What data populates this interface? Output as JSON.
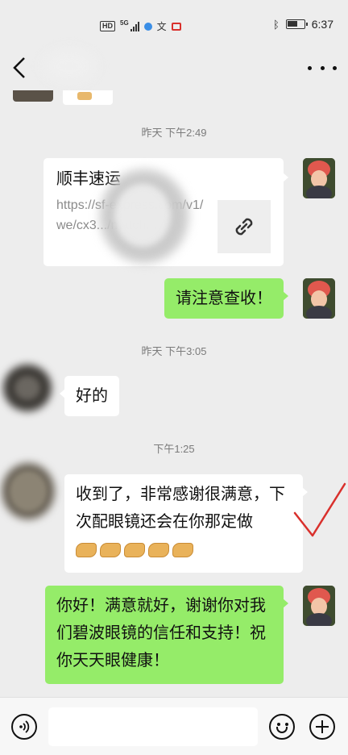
{
  "status_bar": {
    "hd_label": "HD",
    "network_label": "5G",
    "app_icon_text": "文",
    "time": "6:37"
  },
  "messages": [
    {
      "type": "time",
      "text": "昨天 下午2:49"
    },
    {
      "type": "link_card",
      "side": "right",
      "title": "顺丰速运",
      "description": "https://sf-express.com/v1/we/cx3.../match..."
    },
    {
      "type": "text",
      "side": "right",
      "text": "请注意查收！"
    },
    {
      "type": "time",
      "text": "昨天 下午3:05"
    },
    {
      "type": "text",
      "side": "left",
      "text": "好的"
    },
    {
      "type": "time",
      "text": "下午1:25"
    },
    {
      "type": "text",
      "side": "left",
      "text": "收到了，非常感谢很满意，下次配眼镜还会在你那定做",
      "emoji": [
        "ok-hand",
        "ok-hand",
        "handshake",
        "handshake",
        "handshake"
      ]
    },
    {
      "type": "text",
      "side": "right",
      "text": "你好！满意就好，谢谢你对我们碧波眼镜的信任和支持！祝你天天眼健康！"
    }
  ],
  "input_bar": {
    "placeholder": ""
  },
  "colors": {
    "background": "#ededed",
    "sent_bubble": "#95ec69",
    "received_bubble": "#ffffff",
    "check_mark": "#d9302c"
  },
  "icons": [
    "back-arrow-icon",
    "more-dots-icon",
    "link-icon",
    "voice-icon",
    "emoji-icon",
    "plus-icon",
    "check-mark-icon"
  ]
}
